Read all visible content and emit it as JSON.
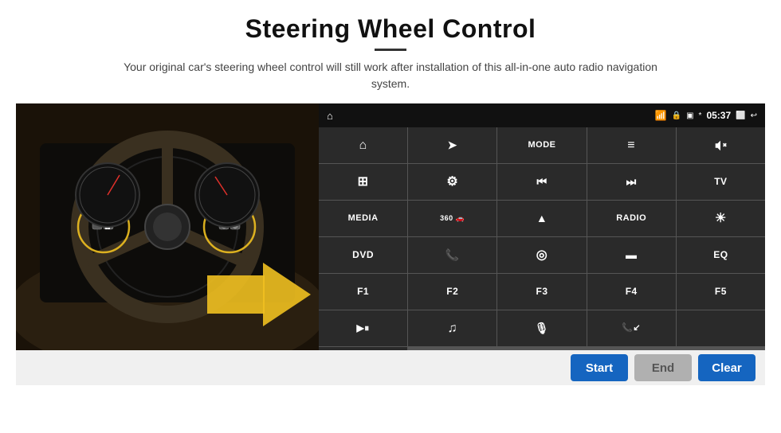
{
  "title": "Steering Wheel Control",
  "divider": true,
  "subtitle": "Your original car's steering wheel control will still work after installation of this all-in-one auto radio navigation system.",
  "status_bar": {
    "time": "05:37",
    "icons": [
      "wifi",
      "lock",
      "sim",
      "bluetooth",
      "cast",
      "back"
    ]
  },
  "grid_buttons": [
    {
      "id": "home",
      "type": "icon",
      "label": "⌂"
    },
    {
      "id": "nav",
      "type": "icon",
      "label": "➤"
    },
    {
      "id": "mode",
      "type": "text",
      "label": "MODE"
    },
    {
      "id": "menu",
      "type": "icon",
      "label": "≡"
    },
    {
      "id": "mute",
      "type": "icon",
      "label": "🔇"
    },
    {
      "id": "apps",
      "type": "icon",
      "label": "⊞"
    },
    {
      "id": "settings",
      "type": "icon",
      "label": "⚙"
    },
    {
      "id": "prev",
      "type": "icon",
      "label": "⏮"
    },
    {
      "id": "next",
      "type": "icon",
      "label": "⏭"
    },
    {
      "id": "tv",
      "type": "text",
      "label": "TV"
    },
    {
      "id": "media",
      "type": "text",
      "label": "MEDIA"
    },
    {
      "id": "cam360",
      "type": "icon",
      "label": "📷360"
    },
    {
      "id": "eject",
      "type": "icon",
      "label": "▲"
    },
    {
      "id": "radio",
      "type": "text",
      "label": "RADIO"
    },
    {
      "id": "brightness",
      "type": "icon",
      "label": "☀"
    },
    {
      "id": "dvd",
      "type": "text",
      "label": "DVD"
    },
    {
      "id": "phone",
      "type": "icon",
      "label": "📞"
    },
    {
      "id": "navi",
      "type": "icon",
      "label": "🧭"
    },
    {
      "id": "screen",
      "type": "icon",
      "label": "▬"
    },
    {
      "id": "eq",
      "type": "text",
      "label": "EQ"
    },
    {
      "id": "f1",
      "type": "text",
      "label": "F1"
    },
    {
      "id": "f2",
      "type": "text",
      "label": "F2"
    },
    {
      "id": "f3",
      "type": "text",
      "label": "F3"
    },
    {
      "id": "f4",
      "type": "text",
      "label": "F4"
    },
    {
      "id": "f5",
      "type": "text",
      "label": "F5"
    },
    {
      "id": "playpause",
      "type": "icon",
      "label": "▶⏸"
    },
    {
      "id": "music",
      "type": "icon",
      "label": "♫"
    },
    {
      "id": "mic",
      "type": "icon",
      "label": "🎙"
    },
    {
      "id": "answer",
      "type": "icon",
      "label": "📞/↙"
    },
    {
      "id": "empty1",
      "type": "text",
      "label": ""
    },
    {
      "id": "empty2",
      "type": "text",
      "label": ""
    }
  ],
  "action_bar": {
    "start_label": "Start",
    "end_label": "End",
    "clear_label": "Clear"
  }
}
